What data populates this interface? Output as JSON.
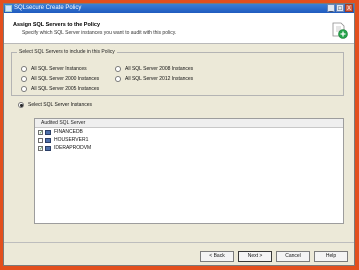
{
  "window": {
    "title": "SQLsecure Create Policy",
    "controls": [
      "_",
      "□",
      "X"
    ]
  },
  "header": {
    "title": "Assign SQL Servers to the Policy",
    "subtitle": "Specify which SQL Server instances you want to audit with this policy."
  },
  "group": {
    "legend": "Select SQL Servers to include in this Policy",
    "options": [
      {
        "label": "All SQL Server Instances",
        "selected": false
      },
      {
        "label": "All SQL Server 2000 Instances",
        "selected": false
      },
      {
        "label": "All SQL Server 2005 Instances",
        "selected": false
      },
      {
        "label": "All SQL Server 2008 Instances",
        "selected": false
      },
      {
        "label": "All SQL Server 2012 Instances",
        "selected": false
      }
    ]
  },
  "select_option": {
    "label": "Select SQL Server Instances",
    "selected": true
  },
  "list": {
    "header": "Audited SQL Server",
    "rows": [
      {
        "name": "FINANCEDB",
        "checked": true
      },
      {
        "name": "HOUSERVER1",
        "checked": false
      },
      {
        "name": "IDERAPRODVM",
        "checked": true
      }
    ]
  },
  "buttons": {
    "back": "< Back",
    "next": "Next >",
    "cancel": "Cancel",
    "help": "Help"
  },
  "colors": {
    "frame": "#e34f1d",
    "titlebar": "#1f5bbf",
    "window_bg": "#ece9d8"
  }
}
